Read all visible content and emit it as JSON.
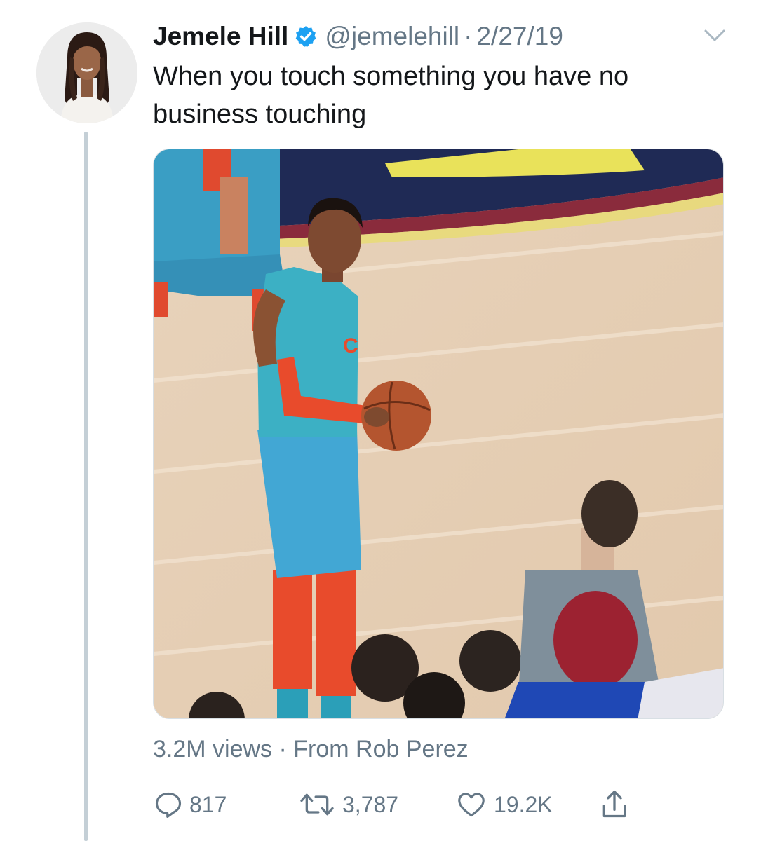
{
  "tweet": {
    "display_name": "Jemele Hill",
    "handle": "@jemelehill",
    "separator": "·",
    "date": "2/27/19",
    "text": "When you touch something you have no business touching",
    "media": {
      "type": "video",
      "views_text": "3.2M views · From Rob Perez"
    },
    "actions": {
      "reply_count": "817",
      "retweet_count": "3,787",
      "like_count": "19.2K"
    }
  },
  "icons": {
    "verified": "verified-badge-icon",
    "menu": "chevron-down-icon",
    "reply": "reply-icon",
    "retweet": "retweet-icon",
    "like": "heart-icon",
    "share": "share-icon"
  },
  "colors": {
    "verified": "#1da1f2",
    "secondary_text": "#657786",
    "thread_line": "#c4cfd6",
    "jersey": "#3fa7c9",
    "sleeve": "#e5482d"
  }
}
